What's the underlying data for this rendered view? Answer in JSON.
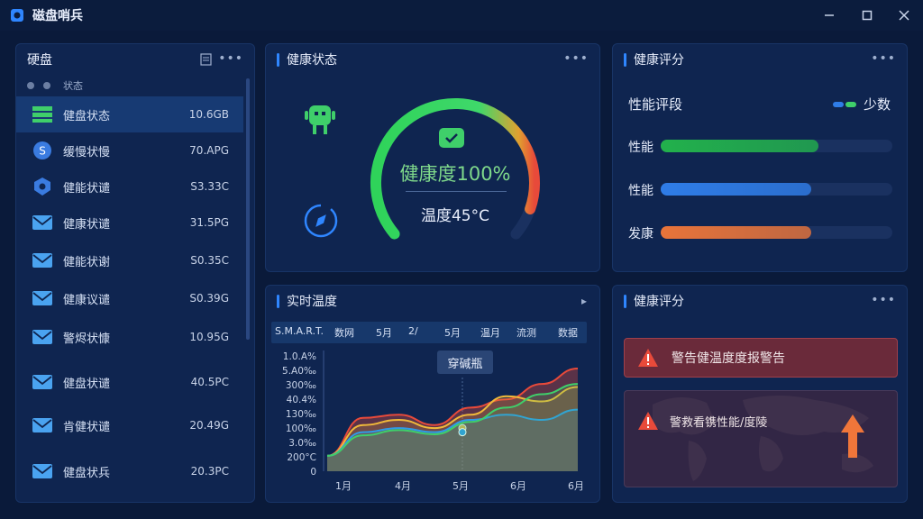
{
  "window": {
    "title": "磁盘哨兵"
  },
  "left_panel": {
    "title": "硬盘",
    "sub_label": "状态",
    "items": [
      {
        "label": "健盘状态",
        "value": "10.6GB",
        "icon": "server-icon"
      },
      {
        "label": "缓慢状慢",
        "value": "70.APG",
        "icon": "dollar-circle-icon"
      },
      {
        "label": "健能状谴",
        "value": "S3.33C",
        "icon": "shield-icon"
      },
      {
        "label": "健康状谴",
        "value": "31.5PG",
        "icon": "mail-icon"
      },
      {
        "label": "健能状谢",
        "value": "S0.35C",
        "icon": "mail-icon"
      },
      {
        "label": "健康议谴",
        "value": "S0.39G",
        "icon": "mail-icon"
      },
      {
        "label": "警烬状慷",
        "value": "10.95G",
        "icon": "mail-icon"
      },
      {
        "label": "健盘状谴",
        "value": "40.5PC",
        "icon": "mail-icon"
      },
      {
        "label": "肯健状谴",
        "value": "20.49G",
        "icon": "mail-icon"
      },
      {
        "label": "健盘状兵",
        "value": "20.3PC",
        "icon": "mail-icon"
      }
    ]
  },
  "health_panel": {
    "title": "健康状态",
    "health_label": "健康度100%",
    "temp_label": "温度45°C",
    "health_value": 100
  },
  "score_panel": {
    "title": "健康评分",
    "subtitle": "性能评段",
    "legend": "少数",
    "bars": [
      {
        "label": "性能",
        "value": 0.68,
        "color": "#22b14c"
      },
      {
        "label": "性能",
        "value": 0.65,
        "color": "#2f7de8"
      },
      {
        "label": "发康",
        "value": 0.65,
        "color": "#e8743a"
      }
    ]
  },
  "temp_panel": {
    "title": "实时温度",
    "header_cells": [
      "S.M.A.R.T.",
      "数网",
      "5月",
      "2/",
      "5月",
      "温月",
      "流测",
      "数据"
    ],
    "tooltip": "穿碱瓶"
  },
  "chart_data": {
    "type": "area",
    "x": [
      "1月",
      "4月",
      "5月",
      "6月",
      "6月"
    ],
    "y_tick_labels": [
      "1.0.A%",
      "5.A0‰",
      "300‰",
      "40.4%",
      "130‰",
      "100‰",
      "3.0‰",
      "200°C",
      "0"
    ],
    "series": [
      {
        "color": "#e84a3a",
        "values": [
          0.15,
          0.52,
          0.55,
          0.45,
          0.62,
          0.7,
          0.85,
          1.0
        ]
      },
      {
        "color": "#f0b93a",
        "values": [
          0.15,
          0.45,
          0.5,
          0.42,
          0.55,
          0.73,
          0.68,
          0.82
        ]
      },
      {
        "color": "#2f9be8",
        "values": [
          0.15,
          0.38,
          0.42,
          0.38,
          0.5,
          0.55,
          0.5,
          0.6
        ]
      },
      {
        "color": "#3fcf6a",
        "values": [
          0.15,
          0.35,
          0.4,
          0.36,
          0.48,
          0.62,
          0.75,
          0.85
        ]
      }
    ]
  },
  "alert_panel": {
    "title": "健康评分",
    "alerts": [
      {
        "text": "警告健温度度报警告"
      },
      {
        "text": "警救看镌性能/度陵"
      }
    ]
  }
}
